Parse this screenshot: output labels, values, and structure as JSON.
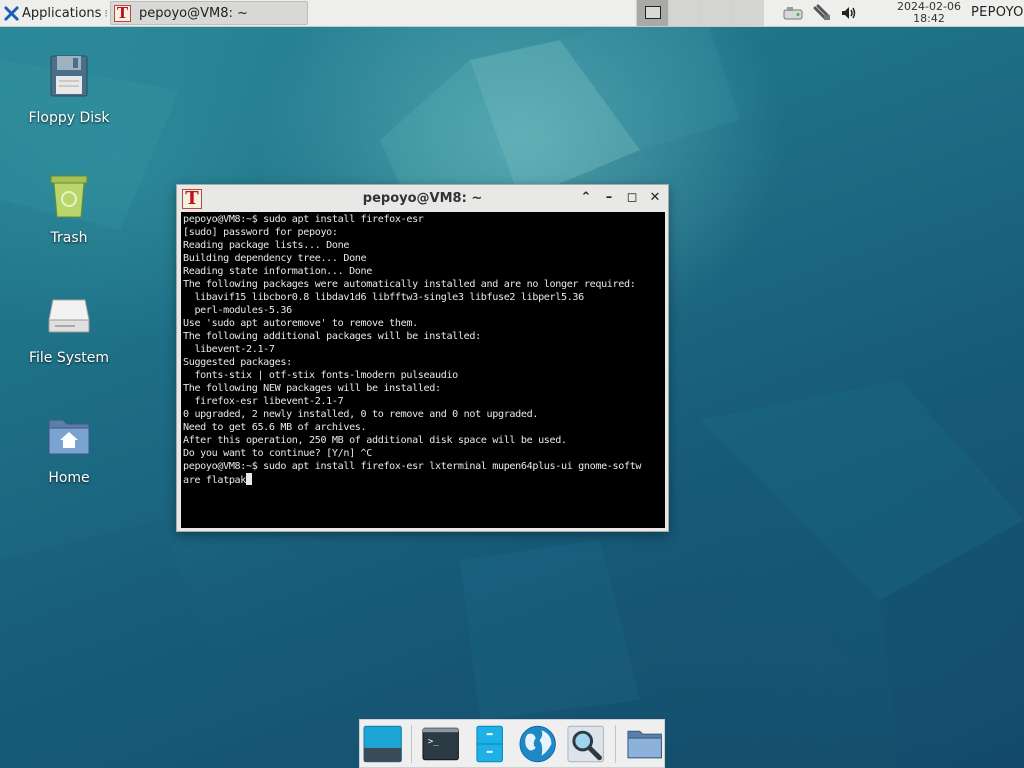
{
  "top_panel": {
    "applications_label": "Applications",
    "task_title": "pepoyo@VM8: ~",
    "clock_date": "2024-02-06",
    "clock_time": "18:42",
    "user": "PEPOYO"
  },
  "desktop": {
    "icons": [
      {
        "label": "Floppy Disk",
        "icon": "floppy-disk-icon"
      },
      {
        "label": "Trash",
        "icon": "trash-icon"
      },
      {
        "label": "File System",
        "icon": "drive-icon"
      },
      {
        "label": "Home",
        "icon": "home-folder-icon"
      }
    ]
  },
  "terminal": {
    "title": "pepoyo@VM8: ~",
    "output": "pepoyo@VM8:~$ sudo apt install firefox-esr\n[sudo] password for pepoyo:\nReading package lists... Done\nBuilding dependency tree... Done\nReading state information... Done\nThe following packages were automatically installed and are no longer required:\n  libavif15 libcbor0.8 libdav1d6 libfftw3-single3 libfuse2 libperl5.36\n  perl-modules-5.36\nUse 'sudo apt autoremove' to remove them.\nThe following additional packages will be installed:\n  libevent-2.1-7\nSuggested packages:\n  fonts-stix | otf-stix fonts-lmodern pulseaudio\nThe following NEW packages will be installed:\n  firefox-esr libevent-2.1-7\n0 upgraded, 2 newly installed, 0 to remove and 0 not upgraded.\nNeed to get 65.6 MB of archives.\nAfter this operation, 250 MB of additional disk space will be used.\nDo you want to continue? [Y/n] ^C\npepoyo@VM8:~$ sudo apt install firefox-esr lxterminal mupen64plus-ui gnome-softw\nare flatpak"
  },
  "dock": {
    "items": [
      "show-desktop-icon",
      "terminal-icon",
      "file-cabinet-icon",
      "web-browser-globe-icon",
      "search-magnifier-icon",
      "folder-icon"
    ]
  },
  "colors": {
    "panel_bg": "#eeeeec",
    "terminal_bg": "#000000",
    "terminal_fg": "#e8e8e8",
    "desktop_teal": "#1e6f86"
  }
}
